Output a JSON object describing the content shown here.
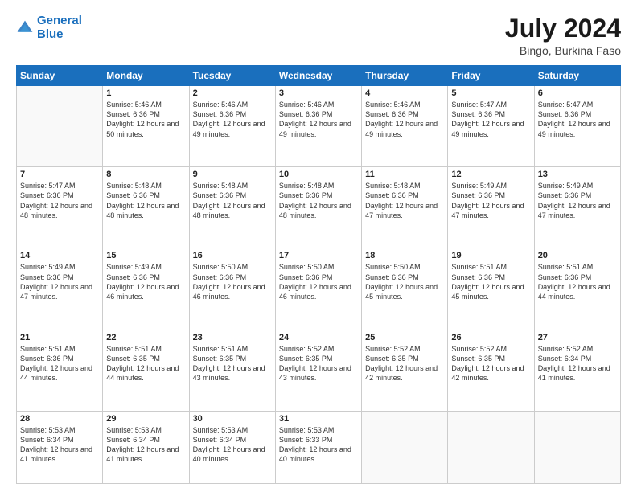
{
  "header": {
    "logo_line1": "General",
    "logo_line2": "Blue",
    "month_year": "July 2024",
    "location": "Bingo, Burkina Faso"
  },
  "days_of_week": [
    "Sunday",
    "Monday",
    "Tuesday",
    "Wednesday",
    "Thursday",
    "Friday",
    "Saturday"
  ],
  "weeks": [
    [
      {
        "day": "",
        "text": ""
      },
      {
        "day": "1",
        "text": "Sunrise: 5:46 AM\nSunset: 6:36 PM\nDaylight: 12 hours\nand 50 minutes."
      },
      {
        "day": "2",
        "text": "Sunrise: 5:46 AM\nSunset: 6:36 PM\nDaylight: 12 hours\nand 49 minutes."
      },
      {
        "day": "3",
        "text": "Sunrise: 5:46 AM\nSunset: 6:36 PM\nDaylight: 12 hours\nand 49 minutes."
      },
      {
        "day": "4",
        "text": "Sunrise: 5:46 AM\nSunset: 6:36 PM\nDaylight: 12 hours\nand 49 minutes."
      },
      {
        "day": "5",
        "text": "Sunrise: 5:47 AM\nSunset: 6:36 PM\nDaylight: 12 hours\nand 49 minutes."
      },
      {
        "day": "6",
        "text": "Sunrise: 5:47 AM\nSunset: 6:36 PM\nDaylight: 12 hours\nand 49 minutes."
      }
    ],
    [
      {
        "day": "7",
        "text": "Sunrise: 5:47 AM\nSunset: 6:36 PM\nDaylight: 12 hours\nand 48 minutes."
      },
      {
        "day": "8",
        "text": "Sunrise: 5:48 AM\nSunset: 6:36 PM\nDaylight: 12 hours\nand 48 minutes."
      },
      {
        "day": "9",
        "text": "Sunrise: 5:48 AM\nSunset: 6:36 PM\nDaylight: 12 hours\nand 48 minutes."
      },
      {
        "day": "10",
        "text": "Sunrise: 5:48 AM\nSunset: 6:36 PM\nDaylight: 12 hours\nand 48 minutes."
      },
      {
        "day": "11",
        "text": "Sunrise: 5:48 AM\nSunset: 6:36 PM\nDaylight: 12 hours\nand 47 minutes."
      },
      {
        "day": "12",
        "text": "Sunrise: 5:49 AM\nSunset: 6:36 PM\nDaylight: 12 hours\nand 47 minutes."
      },
      {
        "day": "13",
        "text": "Sunrise: 5:49 AM\nSunset: 6:36 PM\nDaylight: 12 hours\nand 47 minutes."
      }
    ],
    [
      {
        "day": "14",
        "text": "Sunrise: 5:49 AM\nSunset: 6:36 PM\nDaylight: 12 hours\nand 47 minutes."
      },
      {
        "day": "15",
        "text": "Sunrise: 5:49 AM\nSunset: 6:36 PM\nDaylight: 12 hours\nand 46 minutes."
      },
      {
        "day": "16",
        "text": "Sunrise: 5:50 AM\nSunset: 6:36 PM\nDaylight: 12 hours\nand 46 minutes."
      },
      {
        "day": "17",
        "text": "Sunrise: 5:50 AM\nSunset: 6:36 PM\nDaylight: 12 hours\nand 46 minutes."
      },
      {
        "day": "18",
        "text": "Sunrise: 5:50 AM\nSunset: 6:36 PM\nDaylight: 12 hours\nand 45 minutes."
      },
      {
        "day": "19",
        "text": "Sunrise: 5:51 AM\nSunset: 6:36 PM\nDaylight: 12 hours\nand 45 minutes."
      },
      {
        "day": "20",
        "text": "Sunrise: 5:51 AM\nSunset: 6:36 PM\nDaylight: 12 hours\nand 44 minutes."
      }
    ],
    [
      {
        "day": "21",
        "text": "Sunrise: 5:51 AM\nSunset: 6:36 PM\nDaylight: 12 hours\nand 44 minutes."
      },
      {
        "day": "22",
        "text": "Sunrise: 5:51 AM\nSunset: 6:35 PM\nDaylight: 12 hours\nand 44 minutes."
      },
      {
        "day": "23",
        "text": "Sunrise: 5:51 AM\nSunset: 6:35 PM\nDaylight: 12 hours\nand 43 minutes."
      },
      {
        "day": "24",
        "text": "Sunrise: 5:52 AM\nSunset: 6:35 PM\nDaylight: 12 hours\nand 43 minutes."
      },
      {
        "day": "25",
        "text": "Sunrise: 5:52 AM\nSunset: 6:35 PM\nDaylight: 12 hours\nand 42 minutes."
      },
      {
        "day": "26",
        "text": "Sunrise: 5:52 AM\nSunset: 6:35 PM\nDaylight: 12 hours\nand 42 minutes."
      },
      {
        "day": "27",
        "text": "Sunrise: 5:52 AM\nSunset: 6:34 PM\nDaylight: 12 hours\nand 41 minutes."
      }
    ],
    [
      {
        "day": "28",
        "text": "Sunrise: 5:53 AM\nSunset: 6:34 PM\nDaylight: 12 hours\nand 41 minutes."
      },
      {
        "day": "29",
        "text": "Sunrise: 5:53 AM\nSunset: 6:34 PM\nDaylight: 12 hours\nand 41 minutes."
      },
      {
        "day": "30",
        "text": "Sunrise: 5:53 AM\nSunset: 6:34 PM\nDaylight: 12 hours\nand 40 minutes."
      },
      {
        "day": "31",
        "text": "Sunrise: 5:53 AM\nSunset: 6:33 PM\nDaylight: 12 hours\nand 40 minutes."
      },
      {
        "day": "",
        "text": ""
      },
      {
        "day": "",
        "text": ""
      },
      {
        "day": "",
        "text": ""
      }
    ]
  ]
}
